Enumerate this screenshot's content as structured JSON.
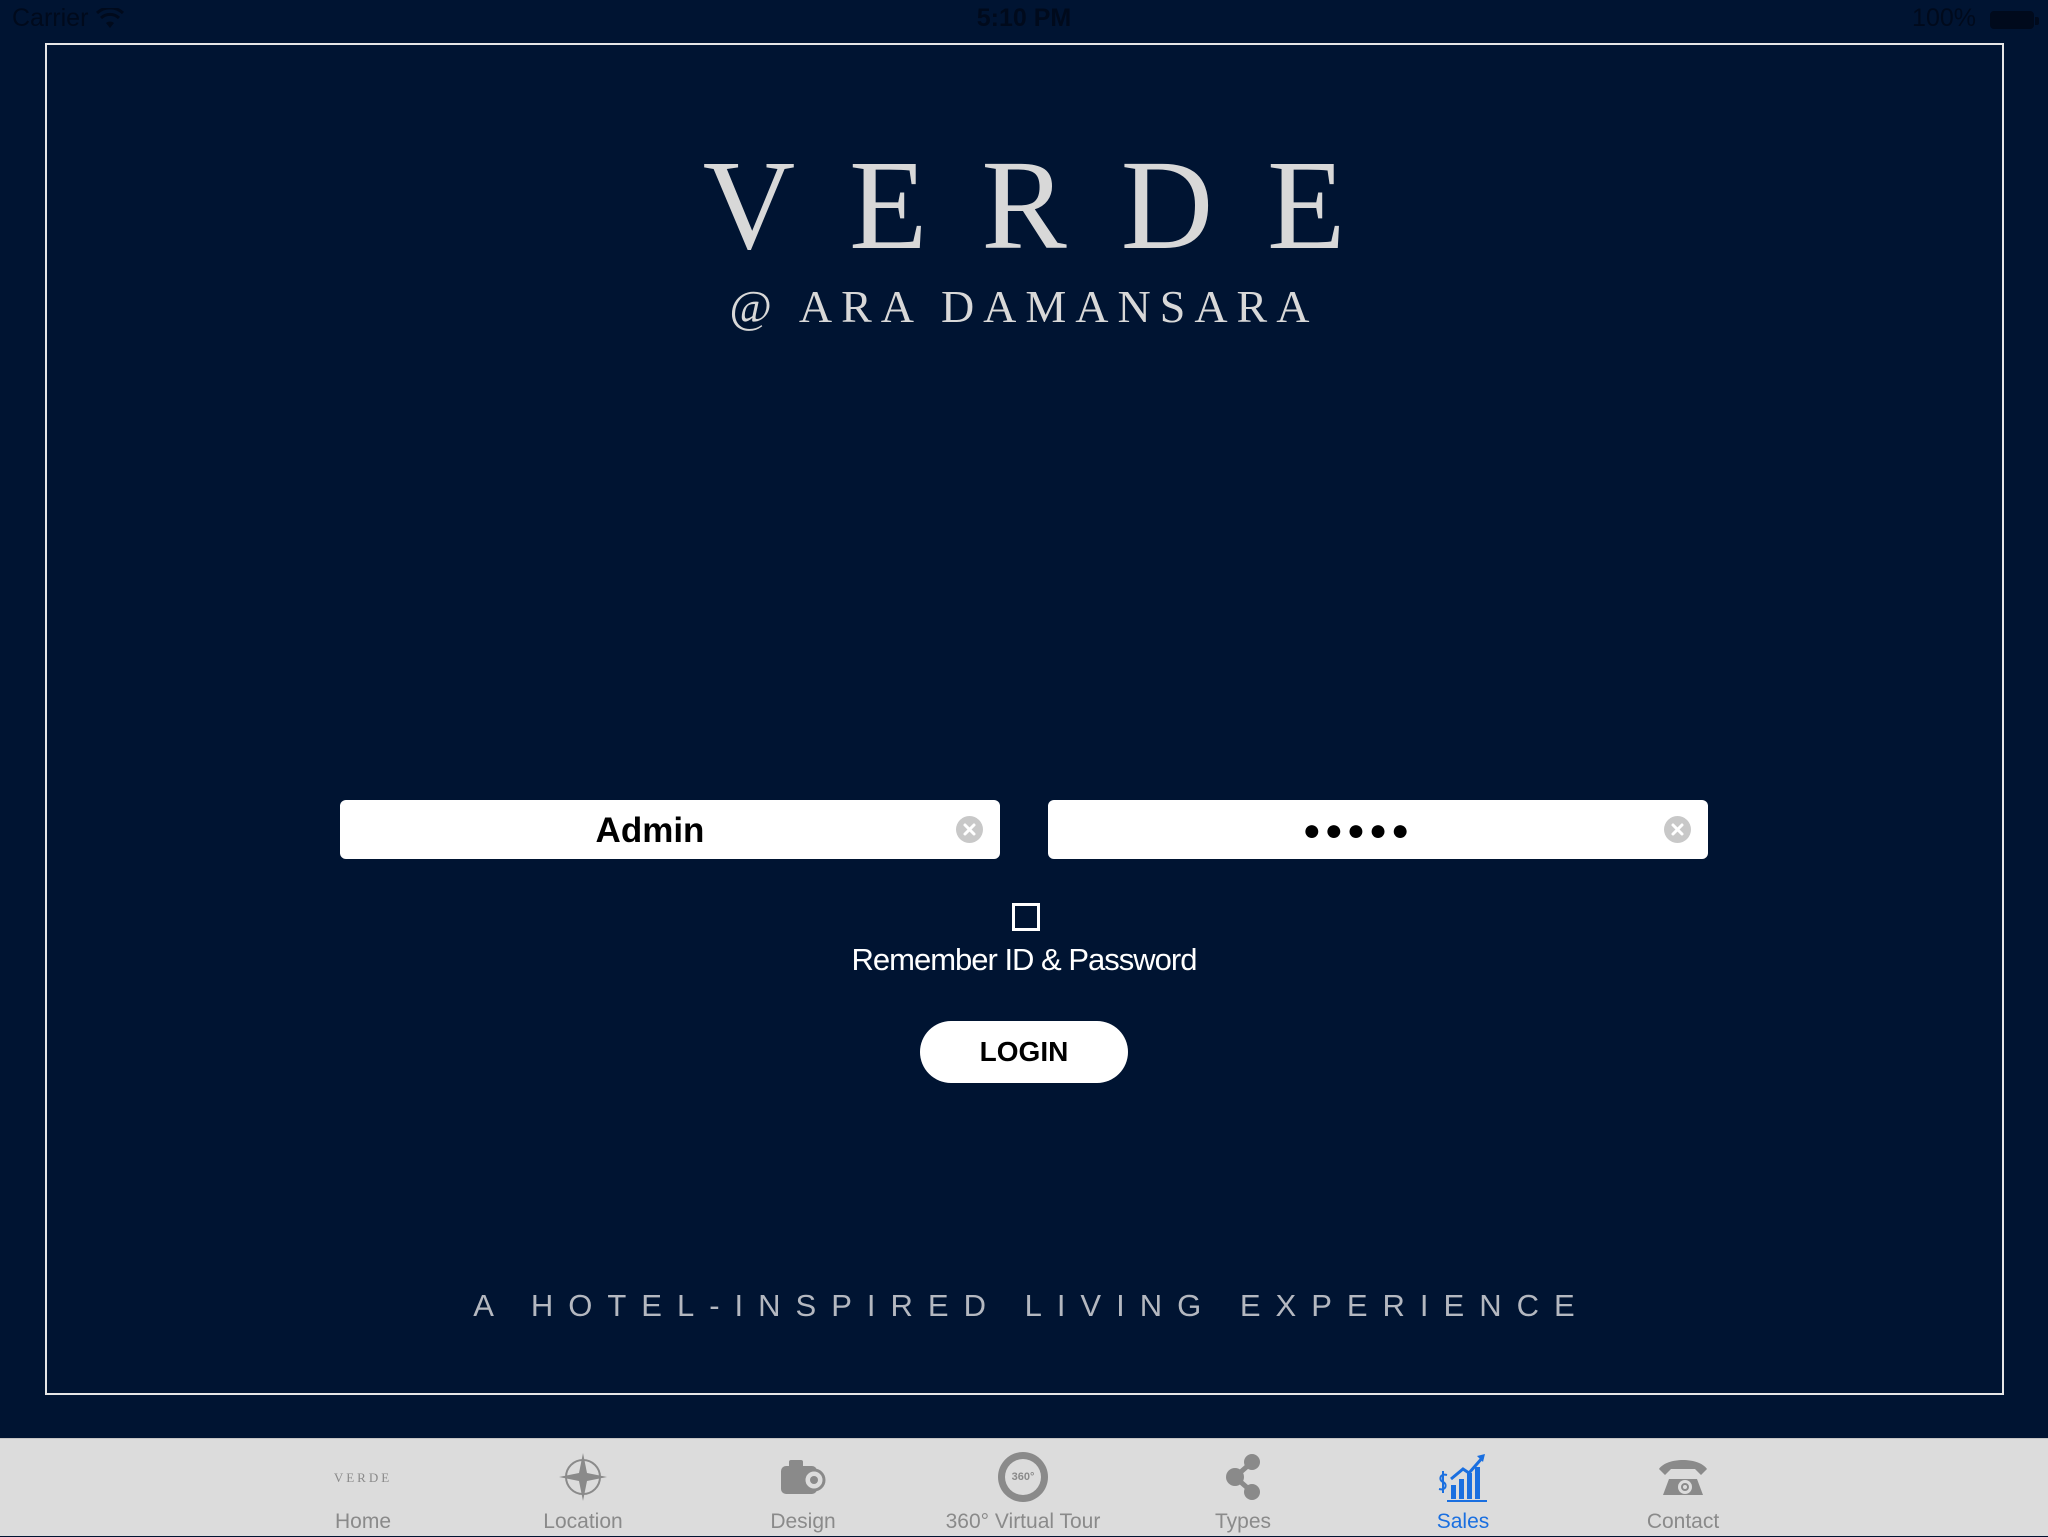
{
  "status_bar": {
    "carrier": "Carrier",
    "time": "5:10 PM",
    "battery": "100%"
  },
  "brand": {
    "title": "VERDE",
    "subtitle": "@ ARA DAMANSARA"
  },
  "login": {
    "username_value": "Admin",
    "password_value": "●●●●●",
    "remember_label": "Remember ID & Password",
    "remember_checked": false,
    "button_label": "LOGIN"
  },
  "tagline": "A HOTEL-INSPIRED LIVING EXPERIENCE",
  "tabs": [
    {
      "label": "Home",
      "icon": "verde-logo-icon",
      "active": false,
      "logo_text": "VERDE"
    },
    {
      "label": "Location",
      "icon": "compass-icon",
      "active": false
    },
    {
      "label": "Design",
      "icon": "camera-icon",
      "active": false
    },
    {
      "label": "360° Virtual Tour",
      "icon": "virtual-tour-360-icon",
      "active": false,
      "badge_text": "360°"
    },
    {
      "label": "Types",
      "icon": "share-icon",
      "active": false
    },
    {
      "label": "Sales",
      "icon": "sales-chart-icon",
      "active": true
    },
    {
      "label": "Contact",
      "icon": "contact-phone-icon",
      "active": false
    }
  ],
  "colors": {
    "background": "#001432",
    "active_tab": "#1a6fe0",
    "tab_bar": "#dcdcdc"
  }
}
